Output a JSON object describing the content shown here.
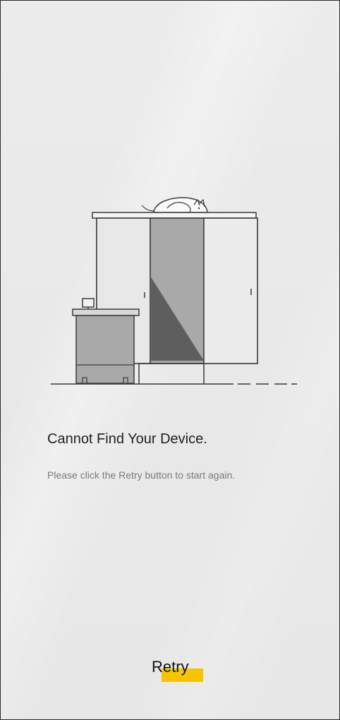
{
  "error": {
    "title": "Cannot Find Your Device.",
    "message": "Please click the Retry button to start again."
  },
  "actions": {
    "retry_label": "Retry"
  },
  "illustration": {
    "name": "empty-room-illustration"
  },
  "colors": {
    "background": "#e9e9e9",
    "accent": "#f7c400",
    "text_primary": "#1f1f1f",
    "text_secondary": "#7a7a7a"
  }
}
